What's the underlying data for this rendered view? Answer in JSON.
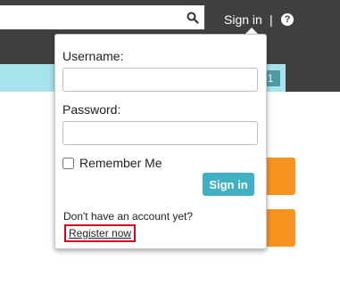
{
  "header": {
    "search_value": "",
    "signin_label": "Sign in",
    "divider": "|",
    "help_glyph": "?"
  },
  "band": {
    "tag": "1"
  },
  "login_popup": {
    "username_label": "Username:",
    "username_value": "",
    "password_label": "Password:",
    "password_value": "",
    "remember_label": "Remember Me",
    "remember_checked": false,
    "signin_button_label": "Sign in",
    "no_account_text": "Don't have an account yet?",
    "register_label": "Register now"
  },
  "colors": {
    "topbar": "#404040",
    "band": "#a6e3ec",
    "signin_button": "#3fb1c3",
    "orange_buttons": "#f7931e",
    "register_highlight": "#d9001b"
  },
  "icons": {
    "search": "search-icon",
    "help": "help-icon"
  }
}
